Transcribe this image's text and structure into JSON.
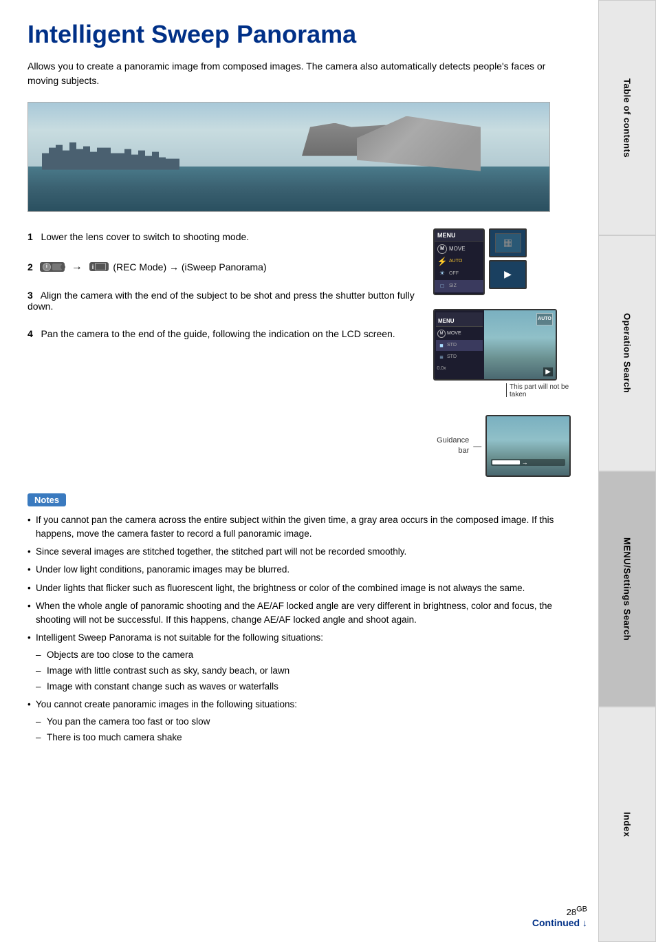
{
  "page": {
    "title": "Intelligent Sweep Panorama",
    "intro": "Allows you to create a panoramic image from composed images. The camera also automatically detects people's faces or moving subjects.",
    "step1": {
      "number": "1",
      "text": "Lower the lens cover to switch to shooting mode."
    },
    "step2": {
      "number": "2",
      "text_prefix": "",
      "rec_label": "iC",
      "arrow": "→",
      "isweep_label": "i□",
      "text_suffix": "(REC Mode) → (iSweep Panorama)"
    },
    "step3": {
      "number": "3",
      "text": "Align the camera with the end of the subject to be shot and press the shutter button fully down.",
      "caption": "This part will not be taken"
    },
    "step4": {
      "number": "4",
      "text": "Pan the camera to the end of the guide, following the indication on the LCD screen.",
      "guidance_label": "Guidance bar"
    },
    "notes": {
      "label": "Notes",
      "items": [
        "If you cannot pan the camera across the entire subject within the given time, a gray area occurs in the composed image. If this happens, move the camera faster to record a full panoramic image.",
        "Since several images are stitched together, the stitched part will not be recorded smoothly.",
        "Under low light conditions, panoramic images may be blurred.",
        "Under lights that flicker such as fluorescent light, the brightness or color of the combined image is not always the same.",
        "When the whole angle of panoramic shooting and the AE/AF locked angle are very different in brightness, color and focus, the shooting will not be successful. If this happens, change AE/AF locked angle and shoot again.",
        "Intelligent Sweep Panorama is not suitable for the following situations:",
        "You cannot create panoramic images in the following situations:"
      ],
      "sublist1": [
        "Objects are too close to the camera",
        "Image with little contrast such as sky, sandy beach, or lawn",
        "Image with constant change such as waves or waterfalls"
      ],
      "sublist2": [
        "You pan the camera too fast or too slow",
        "There is too much camera shake"
      ]
    },
    "footer": {
      "page_number": "28",
      "gb_label": "GB",
      "continued": "Continued ↓"
    }
  },
  "sidebar": {
    "tabs": [
      {
        "id": "table-of-contents",
        "label": "Table of contents"
      },
      {
        "id": "operation-search",
        "label": "Operation Search"
      },
      {
        "id": "menu-settings-search",
        "label": "MENU/Settings Search"
      },
      {
        "id": "index",
        "label": "Index"
      }
    ]
  }
}
